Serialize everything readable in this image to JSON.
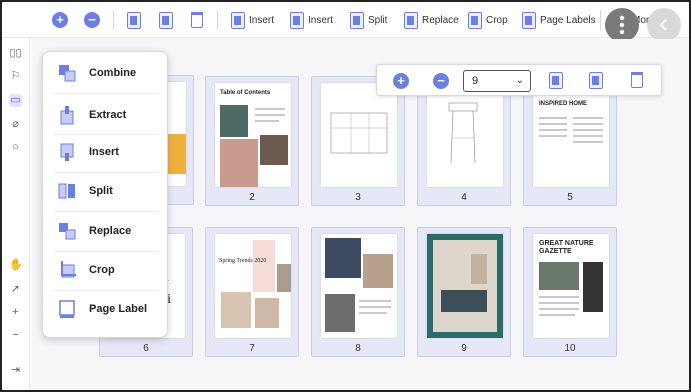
{
  "toolbar": {
    "insert_before_label": "Insert",
    "insert_after_label": "Insert",
    "split_label": "Split",
    "replace_label": "Replace",
    "crop_label": "Crop",
    "page_labels_label": "Page Labels",
    "more_label": "More"
  },
  "organize_menu": {
    "items": [
      {
        "label": "Combine",
        "icon": "combine-icon"
      },
      {
        "label": "Extract",
        "icon": "extract-icon"
      },
      {
        "label": "Insert",
        "icon": "insert-icon"
      },
      {
        "label": "Split",
        "icon": "split-icon"
      },
      {
        "label": "Replace",
        "icon": "replace-icon"
      },
      {
        "label": "Crop",
        "icon": "crop-icon"
      },
      {
        "label": "Page Label",
        "icon": "page-label-icon"
      }
    ]
  },
  "page_toolbar": {
    "page_value": "9"
  },
  "thumbnails": {
    "row1": [
      "2",
      "3",
      "4",
      "5"
    ],
    "row2": [
      "6",
      "7",
      "8",
      "9",
      "10"
    ]
  },
  "page_content": {
    "p2_heading": "Table of Contents",
    "p5_heading": "INSPIRED HOME",
    "p6_text_1": "ttery",
    "p6_text_2": "rkshi",
    "p7_heading": "Spring Trends 2020",
    "p10_heading": "GREAT NATURE GAZETTE"
  },
  "colors": {
    "accent": "#6a7fe0",
    "thumb_selected": "#e7e8f7",
    "thumb_border": "#c9cdf0"
  }
}
